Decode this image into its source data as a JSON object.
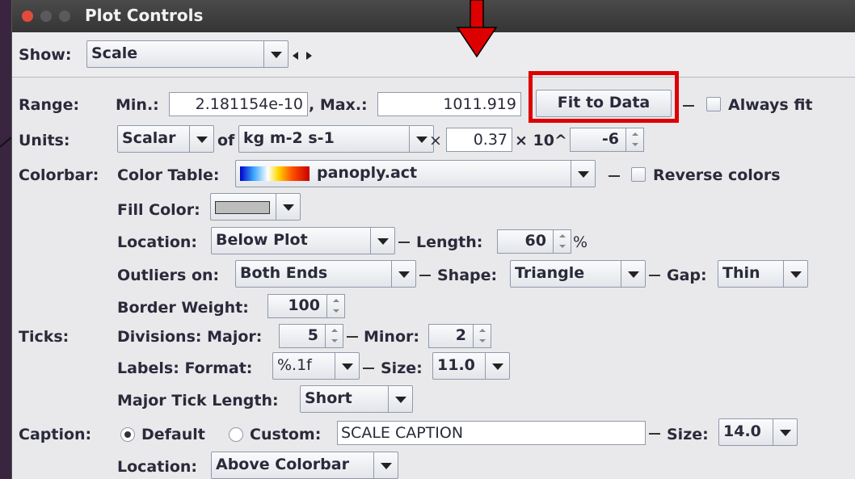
{
  "window": {
    "title": "Plot Controls"
  },
  "top": {
    "show_label": "Show:",
    "show_value": "Scale"
  },
  "range": {
    "label": "Range:",
    "min_label": "Min.:",
    "min_value": "2.181154e-10",
    "max_label": ", Max.:",
    "max_value": "1011.919",
    "fit_button": "Fit to Data",
    "always_fit_label": "Always fit"
  },
  "units": {
    "label": "Units:",
    "type_value": "Scalar",
    "of_label": "of",
    "unit_value": "kg m-2 s-1",
    "times_label": "×",
    "factor_value": "0.37",
    "pow_label": "× 10^",
    "exponent_value": "-6"
  },
  "colorbar": {
    "label": "Colorbar:",
    "color_table_label": "Color Table:",
    "color_table_value": "panoply.act",
    "reverse_label": "Reverse colors",
    "fill_color_label": "Fill Color:",
    "location_label": "Location:",
    "location_value": "Below Plot",
    "length_label": "Length:",
    "length_value": "60",
    "percent_label": "%",
    "outliers_label": "Outliers on:",
    "outliers_value": "Both Ends",
    "shape_label": "Shape:",
    "shape_value": "Triangle",
    "gap_label": "Gap:",
    "gap_value": "Thin",
    "border_label": "Border Weight:",
    "border_value": "100"
  },
  "ticks": {
    "label": "Ticks:",
    "divisions_label": "Divisions: Major:",
    "major_value": "5",
    "minor_label": "Minor:",
    "minor_value": "2",
    "format_label": "Labels: Format:",
    "format_value": "%.1f",
    "size_label": "Size:",
    "size_value": "11.0",
    "major_length_label": "Major Tick Length:",
    "major_length_value": "Short"
  },
  "caption": {
    "label": "Caption:",
    "default_label": "Default",
    "custom_label": "Custom:",
    "custom_value": "SCALE CAPTION",
    "size_label": "Size:",
    "size_value": "14.0",
    "location_label": "Location:",
    "location_value": "Above Colorbar"
  },
  "colors": {
    "annotation_red": "#dd0000",
    "title_bar": "#3c3c3c",
    "panel_bg": "#e9e9ec",
    "desktop_purple": "#8a5cd6"
  }
}
